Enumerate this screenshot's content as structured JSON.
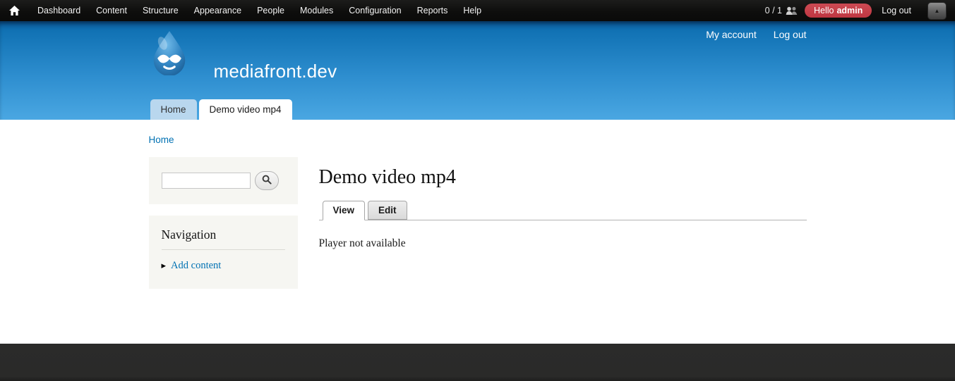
{
  "admin_toolbar": {
    "menu": [
      "Dashboard",
      "Content",
      "Structure",
      "Appearance",
      "People",
      "Modules",
      "Configuration",
      "Reports",
      "Help"
    ],
    "shortcut_count": "0 / 1",
    "greeting_prefix": "Hello",
    "username": "admin",
    "logout_label": "Log out",
    "toggle_icon": "▲"
  },
  "header": {
    "site_name": "mediafront.dev",
    "secondary_menu": {
      "my_account": "My account",
      "logout": "Log out"
    },
    "main_menu": [
      {
        "label": "Home",
        "active": false
      },
      {
        "label": "Demo video mp4",
        "active": true
      }
    ]
  },
  "breadcrumb": {
    "home": "Home"
  },
  "sidebar": {
    "search": {
      "value": ""
    },
    "navigation": {
      "title": "Navigation",
      "items": [
        {
          "label": "Add content",
          "arrow": "▶"
        }
      ]
    }
  },
  "content": {
    "title": "Demo video mp4",
    "tabs": [
      {
        "label": "View",
        "active": true
      },
      {
        "label": "Edit",
        "active": false
      }
    ],
    "body": "Player not available"
  },
  "colors": {
    "link_blue": "#0071b3",
    "header_gradient_top": "#0a5d9e",
    "header_gradient_bottom": "#4aa7e2",
    "badge_red": "#bf3742",
    "inactive_tab_blue": "#b9d7ee",
    "sidebar_block_bg": "#f6f6f2",
    "footer_bg": "#2a2a29",
    "toolbar_bg": "#0e0e0d"
  }
}
